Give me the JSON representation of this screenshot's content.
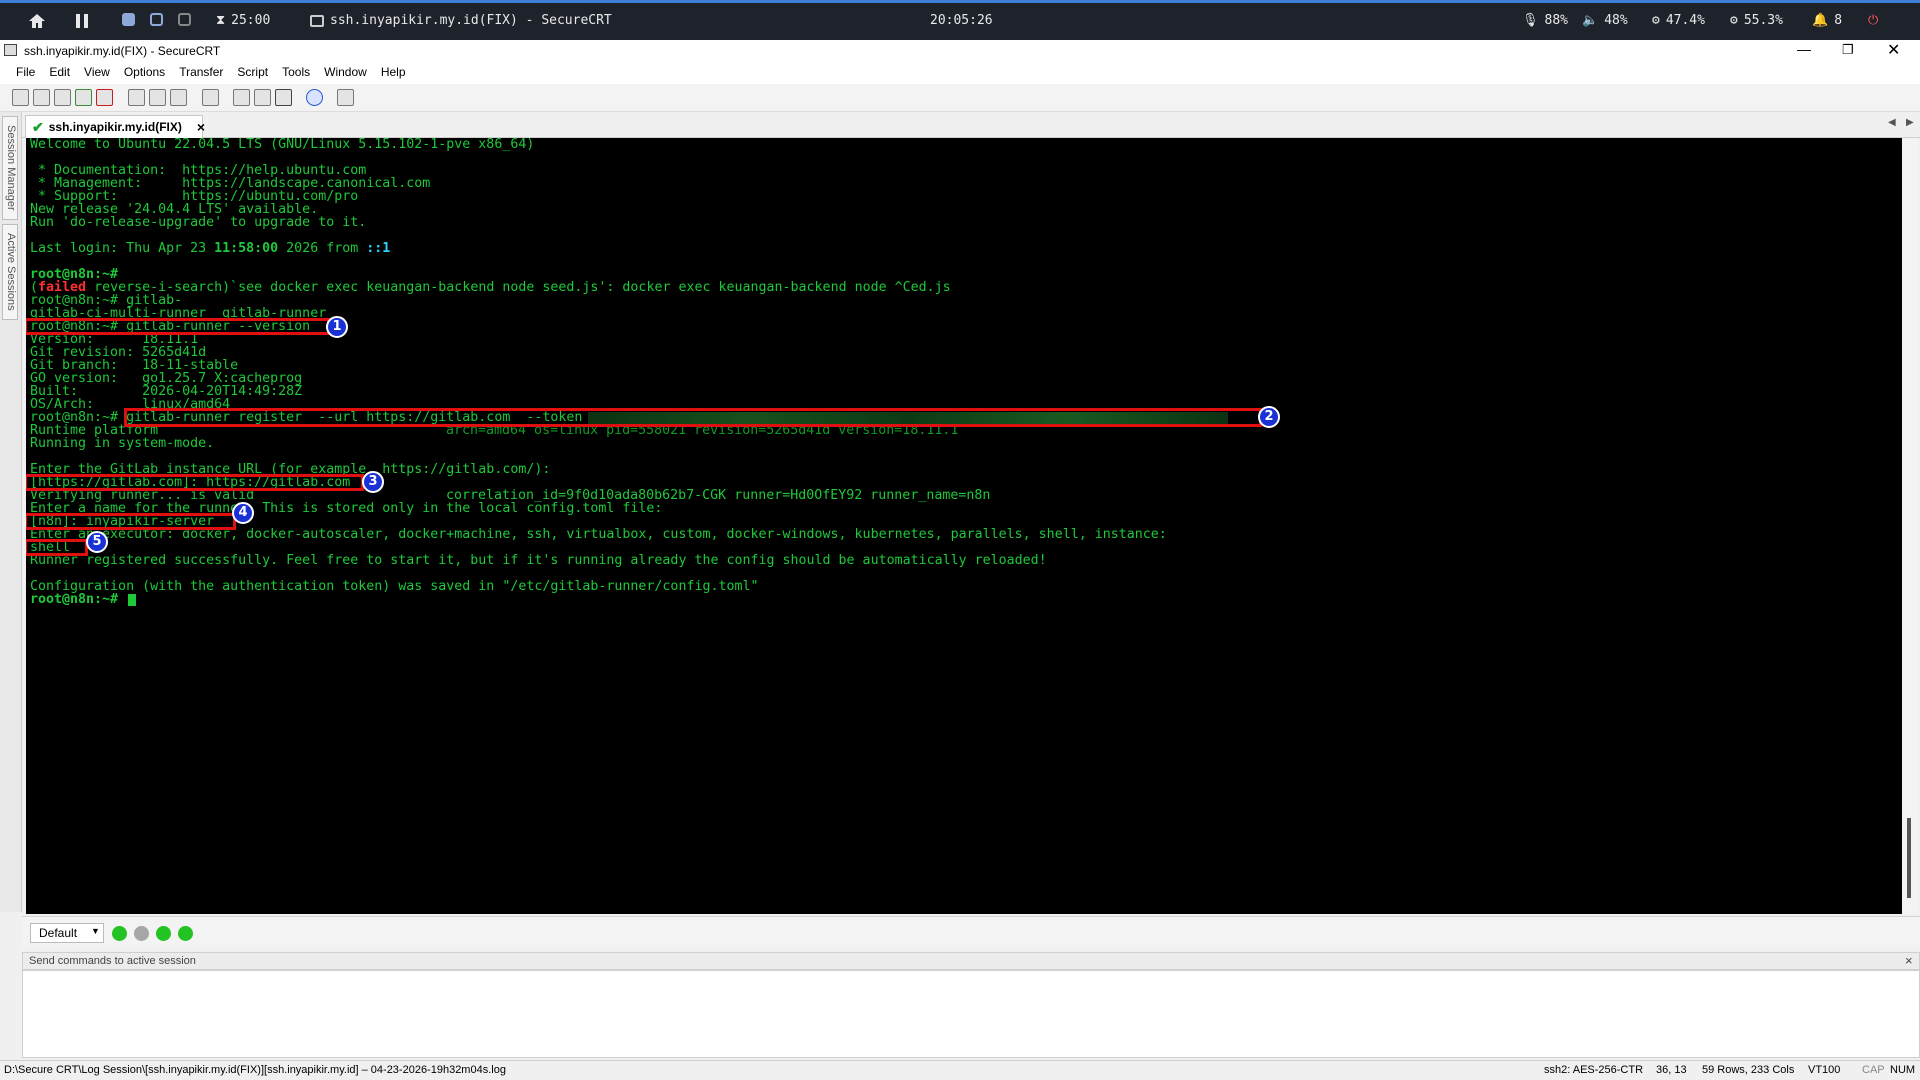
{
  "sysbar": {
    "timer": "25:00",
    "window_name": "ssh.inyapikir.my.id(FIX) - SecureCRT",
    "clock": "20:05:26",
    "mic": "88%",
    "volume": "48%",
    "cpu": "47.4%",
    "ram": "55.3%",
    "notifications": "8"
  },
  "window": {
    "title": "ssh.inyapikir.my.id(FIX) - SecureCRT"
  },
  "menu": [
    "File",
    "Edit",
    "View",
    "Options",
    "Transfer",
    "Script",
    "Tools",
    "Window",
    "Help"
  ],
  "side_tabs": [
    "Session Manager",
    "Active Sessions"
  ],
  "session_tab": {
    "label": "ssh.inyapikir.my.id(FIX)",
    "close": "×"
  },
  "terminal": {
    "l01": "Welcome to Ubuntu 22.04.5 LTS (GNU/Linux 5.15.102-1-pve x86_64)",
    "l02": " * Documentation:  https://help.ubuntu.com",
    "l03": " * Management:     https://landscape.canonical.com",
    "l04": " * Support:        https://ubuntu.com/pro",
    "l05": "New release '24.04.4 LTS' available.",
    "l06": "Run 'do-release-upgrade' to upgrade to it.",
    "l07a": "Last login: Thu Apr 23 ",
    "l07b": "11:58:00",
    "l07c": " 2026 from ",
    "l07d": "::1",
    "l08": "root@n8n:~#",
    "l09a": "(",
    "l09b": "failed",
    "l09c": " reverse-i-search)`see docker exec keuangan-backend node seed.js': docker exec keuangan-backend node ^Ced.js",
    "l10": "root@n8n:~# gitlab-",
    "l11": "gitlab-ci-multi-runner  gitlab-runner",
    "l12": "root@n8n:~# gitlab-runner --version",
    "l13": "Version:      18.11.1",
    "l14": "Git revision: 5265d41d",
    "l15": "Git branch:   18-11-stable",
    "l16": "GO version:   go1.25.7 X:cacheprog",
    "l17": "Built:        2026-04-20T14:49:28Z",
    "l18": "OS/Arch:      linux/amd64",
    "l19": "root@n8n:~# gitlab-runner register  --url https://gitlab.com  --token",
    "l20a": "Runtime platform",
    "l20b": "arch=amd64 os=linux pid=558021 revision=5265d41d version=18.11.1",
    "l21": "Running in system-mode.",
    "l22": "Enter the GitLab instance URL (for example, https://gitlab.com/):",
    "l23": "[https://gitlab.com]: https://gitlab.com",
    "l24a": "Verifying runner... is valid",
    "l24b": "correlation_id=9f0d10ada80b62b7-CGK runner=Hd0OfEY92 runner_name=n8n",
    "l25": "Enter a name for the runner. This is stored only in the local config.toml file:",
    "l26": "[n8n]: inyapikir-server",
    "l27": "Enter an executor: docker, docker-autoscaler, docker+machine, ssh, virtualbox, custom, docker-windows, kubernetes, parallels, shell, instance:",
    "l28": "shell",
    "l29": "Runner registered successfully. Feel free to start it, but if it's running already the config should be automatically reloaded!",
    "l30": "Configuration (with the authentication token) was saved in \"/etc/gitlab-runner/config.toml\"",
    "l31": "root@n8n:~#"
  },
  "annotations": [
    "1",
    "2",
    "3",
    "4",
    "5"
  ],
  "button_bar": {
    "label": "Default"
  },
  "command_window": {
    "header": "Send commands to active session",
    "close": "×"
  },
  "status": {
    "log_path": "D:\\Secure CRT\\Log Session\\[ssh.inyapikir.my.id(FIX)][ssh.inyapikir.my.id] – 04-23-2026-19h32m04s.log",
    "cipher": "ssh2: AES-256-CTR",
    "cursor": "36, 13",
    "size": "59 Rows, 233 Cols",
    "term": "VT100",
    "caps": "CAP",
    "num": "NUM"
  },
  "colors": {
    "terminal_fg": "#1ec93a",
    "terminal_bg": "#000000",
    "annotation_box": "#e01010",
    "annotation_badge": "#1a31d6"
  }
}
